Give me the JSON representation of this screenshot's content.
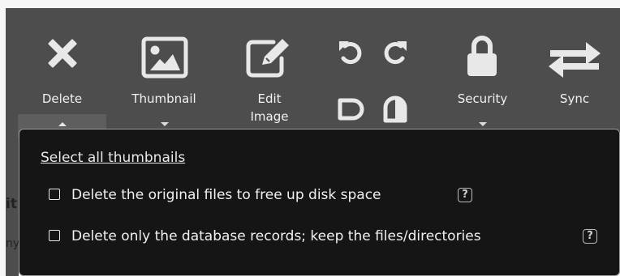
{
  "toolbar": {
    "delete_label": "Delete",
    "thumbnail_label": "Thumbnail",
    "edit_image_line1": "Edit",
    "edit_image_line2": "Image",
    "security_label": "Security",
    "sync_label": "Sync"
  },
  "icons": {
    "delete": "close-x-icon",
    "thumbnail": "image-icon",
    "edit": "edit-pencil-icon",
    "rotate_left": "rotate-ccw-icon",
    "rotate_right": "rotate-cw-icon",
    "flip_horizontal": "flip-horizontal-icon",
    "flip_vertical": "flip-vertical-icon",
    "security": "lock-icon",
    "sync": "sync-arrows-icon"
  },
  "delete_dropdown": {
    "select_all": "Select all thumbnails",
    "options": [
      {
        "label": "Delete the original files to free up disk space",
        "checked": false,
        "help": "?"
      },
      {
        "label": "Delete only the database records; keep the files/directories",
        "checked": false,
        "help": "?"
      }
    ]
  },
  "background_fragments": {
    "frag1": "it",
    "frag2": "ny"
  },
  "colors": {
    "toolbar_bg": "#4d4d4d",
    "dropdown_bg": "#151515",
    "text": "#f1f1f1",
    "active_tab": "#5e5e5e"
  }
}
